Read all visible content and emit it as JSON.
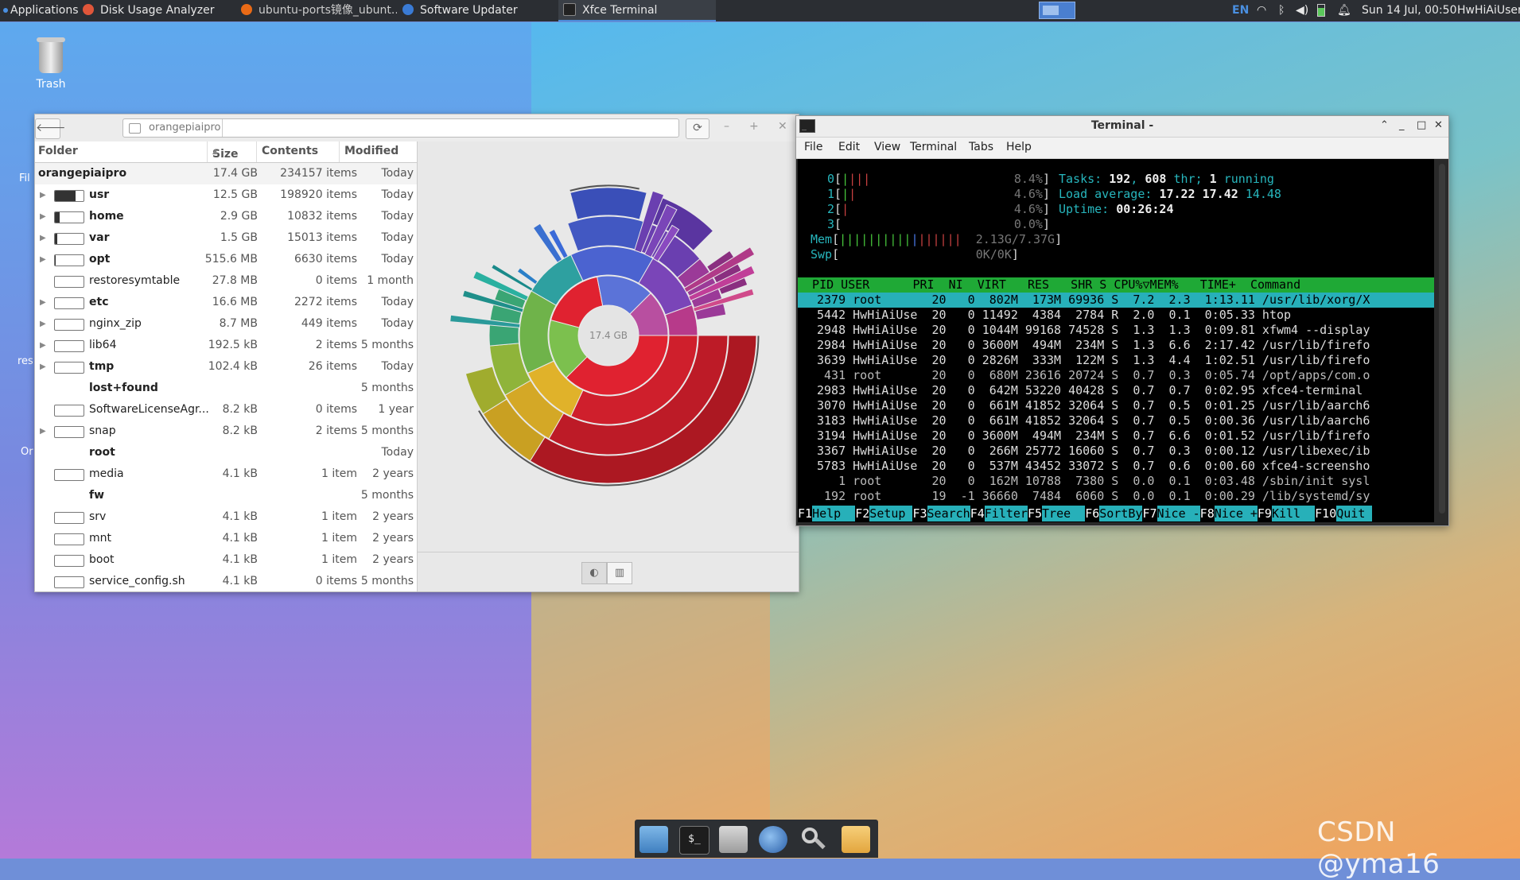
{
  "panel": {
    "applications": "Applications",
    "tasks": [
      {
        "label": "Disk Usage Analyzer",
        "color": "#e0563a"
      },
      {
        "label": "ubuntu-ports镜像_ubunt...",
        "color": "#e96a16"
      },
      {
        "label": "Software Updater",
        "color": "#3a7bd5"
      },
      {
        "label": "Xfce Terminal",
        "color": "#222222",
        "active": true
      }
    ],
    "lang": "EN",
    "clock": "Sun 14 Jul, 00:50",
    "user": "HwHiAiUser"
  },
  "desktop": {
    "trash": "Trash",
    "side_labels": [
      "Fil",
      "res",
      "Or"
    ]
  },
  "disk_usage": {
    "location": "orangepiaipro",
    "columns": [
      "Folder",
      "Size",
      "Contents",
      "Modified"
    ],
    "root": {
      "name": "orangepiaipro",
      "size": "17.4 GB",
      "contents": "234157 items",
      "modified": "Today"
    },
    "rows": [
      {
        "name": "usr",
        "size": "12.5 GB",
        "contents": "198920 items",
        "modified": "Today",
        "bold": true,
        "expand": true,
        "bar": 0.72,
        "show_bar": true
      },
      {
        "name": "home",
        "size": "2.9 GB",
        "contents": "10832 items",
        "modified": "Today",
        "bold": true,
        "expand": true,
        "bar": 0.17,
        "show_bar": true
      },
      {
        "name": "var",
        "size": "1.5 GB",
        "contents": "15013 items",
        "modified": "Today",
        "bold": true,
        "expand": true,
        "bar": 0.09,
        "show_bar": true
      },
      {
        "name": "opt",
        "size": "515.6 MB",
        "contents": "6630 items",
        "modified": "Today",
        "bold": true,
        "expand": true,
        "bar": 0.03,
        "show_bar": true
      },
      {
        "name": "restoresymtable",
        "size": "27.8 MB",
        "contents": "0 items",
        "modified": "1 month",
        "bold": false,
        "expand": false,
        "bar": 0,
        "show_bar": true
      },
      {
        "name": "etc",
        "size": "16.6 MB",
        "contents": "2272 items",
        "modified": "Today",
        "bold": true,
        "expand": true,
        "bar": 0,
        "show_bar": true
      },
      {
        "name": "nginx_zip",
        "size": "8.7 MB",
        "contents": "449 items",
        "modified": "Today",
        "bold": false,
        "expand": true,
        "bar": 0,
        "show_bar": true
      },
      {
        "name": "lib64",
        "size": "192.5 kB",
        "contents": "2 items",
        "modified": "5 months",
        "bold": false,
        "expand": true,
        "bar": 0,
        "show_bar": true
      },
      {
        "name": "tmp",
        "size": "102.4 kB",
        "contents": "26 items",
        "modified": "Today",
        "bold": true,
        "expand": true,
        "bar": 0,
        "show_bar": true
      },
      {
        "name": "lost+found",
        "size": "",
        "contents": "",
        "modified": "5 months",
        "bold": true,
        "expand": false,
        "bar": 0,
        "show_bar": false
      },
      {
        "name": "SoftwareLicenseAgr...",
        "size": "8.2 kB",
        "contents": "0 items",
        "modified": "1 year",
        "bold": false,
        "expand": false,
        "bar": 0,
        "show_bar": true
      },
      {
        "name": "snap",
        "size": "8.2 kB",
        "contents": "2 items",
        "modified": "5 months",
        "bold": false,
        "expand": true,
        "bar": 0,
        "show_bar": true
      },
      {
        "name": "root",
        "size": "",
        "contents": "",
        "modified": "Today",
        "bold": true,
        "expand": false,
        "bar": 0,
        "show_bar": false
      },
      {
        "name": "media",
        "size": "4.1 kB",
        "contents": "1 item",
        "modified": "2 years",
        "bold": false,
        "expand": false,
        "bar": 0,
        "show_bar": true
      },
      {
        "name": "fw",
        "size": "",
        "contents": "",
        "modified": "5 months",
        "bold": true,
        "expand": false,
        "bar": 0,
        "show_bar": false
      },
      {
        "name": "srv",
        "size": "4.1 kB",
        "contents": "1 item",
        "modified": "2 years",
        "bold": false,
        "expand": false,
        "bar": 0,
        "show_bar": true
      },
      {
        "name": "mnt",
        "size": "4.1 kB",
        "contents": "1 item",
        "modified": "2 years",
        "bold": false,
        "expand": false,
        "bar": 0,
        "show_bar": true
      },
      {
        "name": "boot",
        "size": "4.1 kB",
        "contents": "1 item",
        "modified": "2 years",
        "bold": false,
        "expand": false,
        "bar": 0,
        "show_bar": true
      },
      {
        "name": "service_config.sh",
        "size": "4.1 kB",
        "contents": "0 items",
        "modified": "5 months",
        "bold": false,
        "expand": false,
        "bar": 0,
        "show_bar": true
      }
    ],
    "ring_center_label": "17.4 GB"
  },
  "terminal": {
    "title": "Terminal -",
    "menu": [
      "File",
      "Edit",
      "View",
      "Terminal",
      "Tabs",
      "Help"
    ],
    "cpus": [
      {
        "id": "0",
        "pct": "8.4%"
      },
      {
        "id": "1",
        "pct": "4.6%"
      },
      {
        "id": "2",
        "pct": "4.6%"
      },
      {
        "id": "3",
        "pct": "0.0%"
      }
    ],
    "mem": "2.13G/7.37G",
    "swp": "0K/0K",
    "tasks_label": "Tasks:",
    "tasks": "192",
    "thr": "608",
    "running": "1",
    "load_label": "Load average:",
    "load1": "17.22",
    "load5": "17.42",
    "load15": "14.48",
    "uptime_label": "Uptime:",
    "uptime": "00:26:24",
    "header": "  PID USER      PRI  NI  VIRT   RES   SHR S CPU%▽MEM%   TIME+  Command",
    "procs": [
      "2379 root       20   0  802M  173M 69936 S  7.2  2.3  1:13.11 /usr/lib/xorg/X",
      "5442 HwHiAiUse  20   0 11492  4384  2784 R  2.0  0.1  0:05.33 htop",
      "2948 HwHiAiUse  20   0 1044M 99168 74528 S  1.3  1.3  0:09.81 xfwm4 --display",
      "2984 HwHiAiUse  20   0 3600M  494M  234M S  1.3  6.6  2:17.42 /usr/lib/firefo",
      "3639 HwHiAiUse  20   0 2826M  333M  122M S  1.3  4.4  1:02.51 /usr/lib/firefo",
      " 431 root       20   0  680M 23616 20724 S  0.7  0.3  0:05.74 /opt/apps/com.o",
      "2983 HwHiAiUse  20   0  642M 53220 40428 S  0.7  0.7  0:02.95 xfce4-terminal",
      "3070 HwHiAiUse  20   0  661M 41852 32064 S  0.7  0.5  0:01.25 /usr/lib/aarch6",
      "3183 HwHiAiUse  20   0  661M 41852 32064 S  0.7  0.5  0:00.36 /usr/lib/aarch6",
      "3194 HwHiAiUse  20   0 3600M  494M  234M S  0.7  6.6  0:01.52 /usr/lib/firefo",
      "3367 HwHiAiUse  20   0  266M 25772 16060 S  0.7  0.3  0:00.12 /usr/libexec/ib",
      "5783 HwHiAiUse  20   0  537M 43452 33072 S  0.7  0.6  0:00.60 xfce4-screensho",
      "   1 root       20   0  162M 10788  7380 S  0.0  0.1  0:03.48 /sbin/init sysl",
      " 192 root       19  -1 36660  7484  6060 S  0.0  0.1  0:00.29 /lib/systemd/sy"
    ],
    "fkeys": [
      {
        "k": "F1",
        "v": "Help  "
      },
      {
        "k": "F2",
        "v": "Setup "
      },
      {
        "k": "F3",
        "v": "Search"
      },
      {
        "k": "F4",
        "v": "Filter"
      },
      {
        "k": "F5",
        "v": "Tree  "
      },
      {
        "k": "F6",
        "v": "SortBy"
      },
      {
        "k": "F7",
        "v": "Nice -"
      },
      {
        "k": "F8",
        "v": "Nice +"
      },
      {
        "k": "F9",
        "v": "Kill  "
      },
      {
        "k": "F10",
        "v": "Quit "
      }
    ]
  },
  "dock": [
    "file-manager-icon",
    "terminal-icon",
    "home-folder-icon",
    "web-browser-icon",
    "app-finder-icon",
    "folder-icon"
  ],
  "watermark": "CSDN @yma16"
}
